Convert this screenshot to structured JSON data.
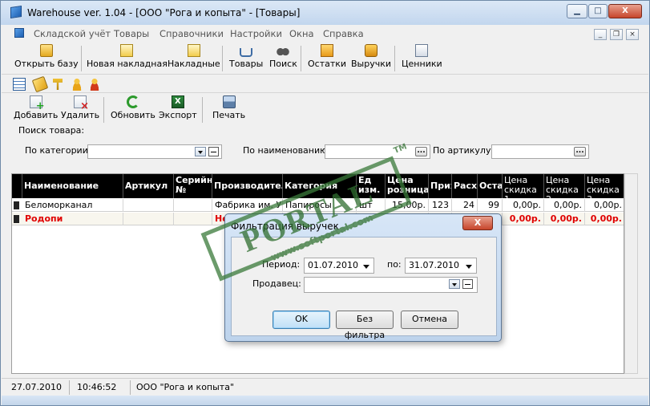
{
  "window": {
    "title": "Warehouse ver. 1.04 - [ООО \"Рога и копыта\" - [Товары]",
    "minimize_glyph": "▁",
    "maximize_glyph": "□",
    "close_glyph": "X"
  },
  "menu": {
    "items": [
      "Складской учёт",
      "Товары",
      "Справочники",
      "Настройки",
      "Окна",
      "Справка"
    ],
    "mdi_minimize_glyph": "_",
    "mdi_restore_glyph": "❐",
    "mdi_close_glyph": "×"
  },
  "toolbar_main": {
    "open_db": "Открыть базу",
    "new_invoice": "Новая накладная",
    "invoices": "Накладные",
    "goods": "Товары",
    "search": "Поиск",
    "stock": "Остатки",
    "revenue": "Выручки",
    "price_tags": "Ценники"
  },
  "toolbar_actions": {
    "add": "Добавить",
    "delete": "Удалить",
    "refresh": "Обновить",
    "export": "Экспорт",
    "print": "Печать",
    "excel_glyph": "X"
  },
  "search": {
    "legend": "Поиск товара:",
    "by_category": "По категории:",
    "by_name": "По наименованию:",
    "by_sku": "По артикулу:",
    "dots": "..."
  },
  "grid": {
    "headers": [
      "Наименование",
      "Артикул",
      "Серийн №",
      "Производител",
      "Категория",
      "Ед изм.",
      "Цена розница",
      "Приход",
      "Расход",
      "Остаток",
      "Цена скидка 1",
      "Цена скидка 2",
      "Цена скидка 3"
    ],
    "rows": [
      [
        "Беломорканал",
        "",
        "",
        "Фабрика им. Ур",
        "Папиросы",
        "шт",
        "15,00р.",
        "123",
        "24",
        "99",
        "0,00р.",
        "0,00р.",
        "0,00р."
      ],
      [
        "Родопи",
        "",
        "",
        "Не",
        "",
        "",
        "",
        "",
        "",
        "",
        "0,00р.",
        "0,00р.",
        "0,00р."
      ]
    ]
  },
  "status": {
    "date": "27.07.2010",
    "time": "10:46:52",
    "company": "ООО \"Рога и копыта\""
  },
  "dialog": {
    "title": "Фильтрация выручек",
    "close_glyph": "X",
    "period_label": "Период:",
    "period_from": "01.07.2010",
    "period_to_label": "по:",
    "period_to": "31.07.2010",
    "seller_label": "Продавец:",
    "seller_value": "",
    "ok": "OK",
    "no_filter": "Без фильтра",
    "cancel": "Отмена"
  },
  "watermark": {
    "text": "PORTAL",
    "url": "www.softportal.com",
    "tm": "TM"
  },
  "colors": {
    "row_red": "#e00000",
    "header_bg": "#000000",
    "title_bg": "#c2d6ee"
  }
}
